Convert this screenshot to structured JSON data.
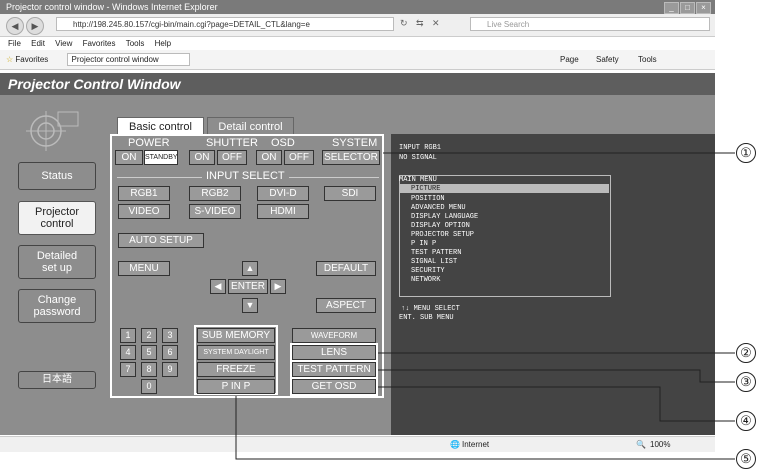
{
  "browser": {
    "title": "Projector control window - Windows Internet Explorer",
    "address": "http://198.245.80.157/cgi-bin/main.cgi?page=DETAIL_CTL&lang=e",
    "search_placeholder": "Live Search",
    "menu": [
      "File",
      "Edit",
      "View",
      "Favorites",
      "Tools",
      "Help"
    ],
    "favorites": "Favorites",
    "tab_title": "Projector control window",
    "toolbar_items": [
      "Page",
      "Safety",
      "Tools"
    ],
    "status_zone": "Internet",
    "zoom": "100%"
  },
  "app": {
    "title": "Projector Control Window",
    "nav": [
      {
        "lines": [
          "Status"
        ]
      },
      {
        "lines": [
          "Projector",
          "control"
        ]
      },
      {
        "lines": [
          "Detailed",
          "set up"
        ]
      },
      {
        "lines": [
          "Change",
          "password"
        ]
      },
      {
        "lines": [
          "日本語"
        ]
      }
    ],
    "tabs": {
      "basic": "Basic control",
      "detail": "Detail control"
    }
  },
  "controls": {
    "power": {
      "label": "POWER",
      "on": "ON",
      "standby": "STANDBY"
    },
    "shutter": {
      "label": "SHUTTER",
      "on": "ON",
      "off": "OFF"
    },
    "osd": {
      "label": "OSD",
      "on": "ON",
      "off": "OFF"
    },
    "system": {
      "label": "SYSTEM",
      "selector": "SELECTOR"
    },
    "input_select": "INPUT SELECT",
    "inputs": [
      "RGB1",
      "RGB2",
      "DVI-D",
      "SDI",
      "VIDEO",
      "S-VIDEO",
      "HDMI"
    ],
    "auto_setup": "AUTO SETUP",
    "menu": "MENU",
    "default": "DEFAULT",
    "enter": "ENTER",
    "aspect": "ASPECT",
    "up": "▲",
    "down": "▼",
    "left": "◀",
    "right": "▶",
    "keypad": [
      "1",
      "2",
      "3",
      "4",
      "5",
      "6",
      "7",
      "8",
      "9",
      "0"
    ],
    "sub_memory": "SUB MEMORY",
    "waveform_monitor": "WAVEFORM MONITOR",
    "system_daylight_view": "SYSTEM DAYLIGHT VIEW",
    "lens": "LENS",
    "freeze": "FREEZE",
    "test_pattern": "TEST PATTERN",
    "p_in_p": "P IN P",
    "get_osd": "GET OSD"
  },
  "osd": {
    "input": "INPUT RGB1",
    "signal": "NO SIGNAL",
    "menu_title": "MAIN MENU",
    "items": [
      "PICTURE",
      "POSITION",
      "ADVANCED MENU",
      "DISPLAY LANGUAGE",
      "DISPLAY OPTION",
      "PROJECTOR SETUP",
      "P IN P",
      "TEST PATTERN",
      "SIGNAL LIST",
      "SECURITY",
      "NETWORK"
    ],
    "footer1": "↑↓   MENU SELECT",
    "footer2": "ENT.  SUB MENU"
  },
  "callouts": [
    "①",
    "②",
    "③",
    "④",
    "⑤"
  ]
}
